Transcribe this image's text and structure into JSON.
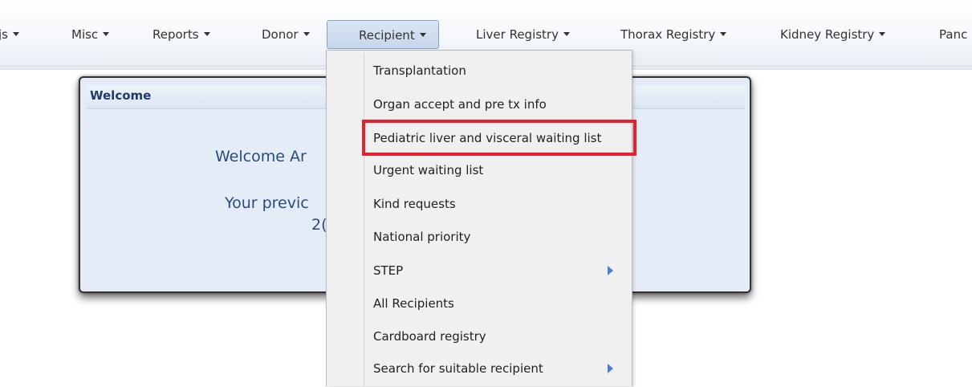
{
  "nav": {
    "items": [
      {
        "label": "js",
        "dropdown": true
      },
      {
        "label": "Misc",
        "dropdown": true
      },
      {
        "label": "Reports",
        "dropdown": true
      },
      {
        "label": "Donor",
        "dropdown": true
      },
      {
        "label": "Recipient",
        "dropdown": true,
        "active": true
      },
      {
        "label": "Liver Registry",
        "dropdown": true
      },
      {
        "label": "Thorax Registry",
        "dropdown": true
      },
      {
        "label": "Kidney Registry",
        "dropdown": true
      },
      {
        "label": "Panc",
        "dropdown": false
      }
    ]
  },
  "welcome": {
    "title": "Welcome",
    "greeting_partial": "Welcome Ar",
    "previous_partial": "Your previc",
    "date_partial": "2("
  },
  "dropdown": {
    "items": [
      {
        "label": "Transplantation"
      },
      {
        "label": "Organ accept and pre tx info"
      },
      {
        "label": "Pediatric liver and visceral waiting list",
        "highlighted": true
      },
      {
        "label": "Urgent waiting list"
      },
      {
        "label": "Kind requests"
      },
      {
        "label": "National priority"
      },
      {
        "label": "STEP",
        "submenu": true
      },
      {
        "label": "All Recipients"
      },
      {
        "label": "Cardboard registry"
      },
      {
        "label": "Search for suitable recipient",
        "submenu": true
      }
    ]
  },
  "colors": {
    "highlight_border": "#e8202a",
    "submenu_arrow": "#4a7fd6",
    "panel_bg": "#e4ecf7",
    "title_text": "#1f3a68"
  }
}
